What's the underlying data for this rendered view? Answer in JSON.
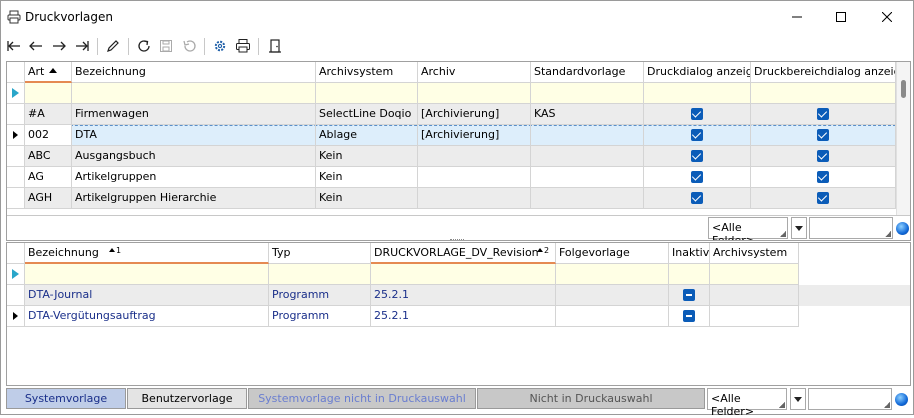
{
  "window": {
    "title": "Druckvorlagen",
    "icon": "printer-window-icon"
  },
  "toolbar": {
    "icons": [
      "first-record-icon",
      "prev-record-icon",
      "next-record-icon",
      "last-record-icon",
      "edit-pencil-icon",
      "refresh-icon",
      "save-icon",
      "undo-icon",
      "settings-gear-icon",
      "print-icon",
      "exit-door-icon"
    ]
  },
  "top_grid": {
    "columns": [
      "Art",
      "Bezeichnung",
      "Archivsystem",
      "Archiv",
      "Standardvorlage",
      "Druckdialog anzeigen",
      "Druckbereichdialog anzeigen"
    ],
    "rows": [
      {
        "art": "#A",
        "bez": "Firmenwagen",
        "sys": "SelectLine Doqio",
        "archiv": "[Archivierung]",
        "std": "KAS",
        "d1": true,
        "d2": true
      },
      {
        "art": "002",
        "bez": "DTA",
        "sys": "Ablage",
        "archiv": "[Archivierung]",
        "std": "",
        "d1": true,
        "d2": true
      },
      {
        "art": "ABC",
        "bez": "Ausgangsbuch",
        "sys": "Kein",
        "archiv": "",
        "std": "",
        "d1": true,
        "d2": true
      },
      {
        "art": "AG",
        "bez": "Artikelgruppen",
        "sys": "Kein",
        "archiv": "",
        "std": "",
        "d1": true,
        "d2": true
      },
      {
        "art": "AGH",
        "bez": "Artikelgruppen Hierarchie",
        "sys": "Kein",
        "archiv": "",
        "std": "",
        "d1": true,
        "d2": true
      }
    ],
    "filter_combo": "<Alle Felder>"
  },
  "bottom_grid": {
    "columns": [
      "Bezeichnung",
      "Typ",
      "DRUCKVORLAGE_DV_Revision",
      "Folgevorlage",
      "Inaktiv",
      "Archivsystem"
    ],
    "sort_badges": [
      "1",
      "2"
    ],
    "rows": [
      {
        "bez": "DTA-Journal",
        "typ": "Programm",
        "rev": "25.2.1",
        "folge": "",
        "inaktiv": true,
        "sys": ""
      },
      {
        "bez": "DTA-Vergütungsauftrag",
        "typ": "Programm",
        "rev": "25.2.1",
        "folge": "",
        "inaktiv": true,
        "sys": ""
      }
    ]
  },
  "footer": {
    "buttons": [
      "Systemvorlage",
      "Benutzervorlage",
      "Systemvorlage nicht in Druckauswahl",
      "Nicht in Druckauswahl"
    ],
    "filter_combo": "<Alle Felder>"
  }
}
